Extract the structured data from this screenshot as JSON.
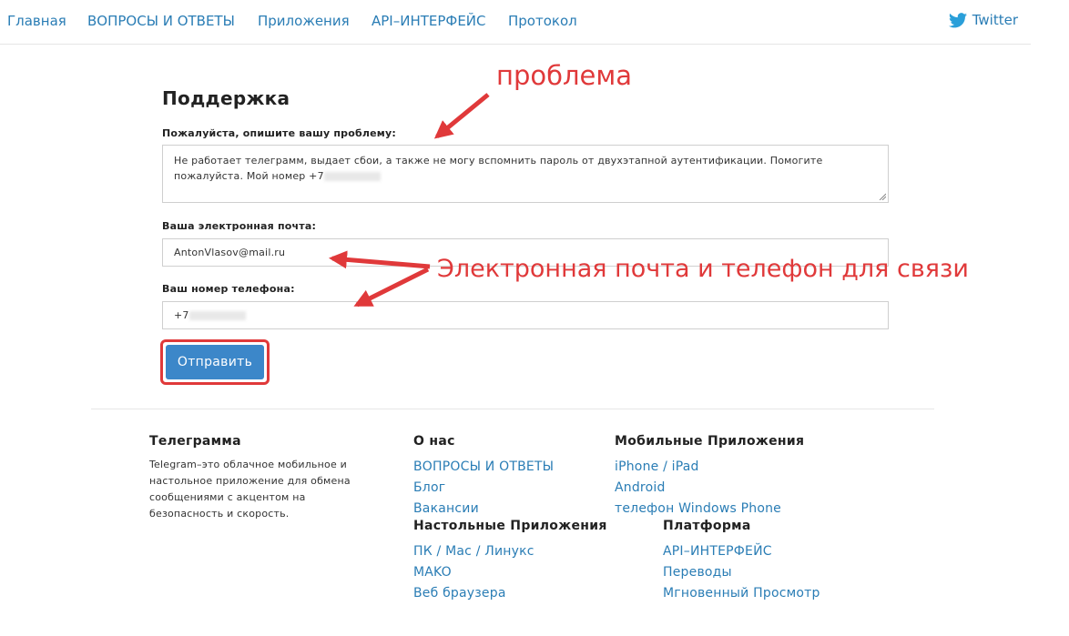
{
  "nav": {
    "items": [
      "Главная",
      "ВОПРОСЫ И ОТВЕТЫ",
      "Приложения",
      "API–ИНТЕРФЕЙС",
      "Протокол"
    ],
    "twitter_label": "Twitter"
  },
  "form": {
    "title": "Поддержка",
    "problem_label": "Пожалуйста, опишите вашу проблему:",
    "problem_text": "Не работает телеграмм, выдает сбои, а также не могу вспомнить пароль от двухэтапной аутентификации. Помогите пожалуйста. Мой номер +7",
    "email_label": "Ваша электронная почта:",
    "email_value": "AntonVlasov@mail.ru",
    "phone_label": "Ваш номер телефона:",
    "phone_value": "+7",
    "submit_label": "Отправить"
  },
  "annotations": {
    "problem": "проблема",
    "contacts": "Электронная почта и телефон для связи",
    "color": "#e0393a"
  },
  "footer": {
    "col1": {
      "title": "Телеграмма",
      "description": "Telegram–это облачное мобильное и настольное приложение для обмена сообщениями с акцентом на безопасность и скорость."
    },
    "about": {
      "title": "О нас",
      "links": [
        "ВОПРОСЫ И ОТВЕТЫ",
        "Блог",
        "Вакансии"
      ]
    },
    "mobile": {
      "title": "Мобильные Приложения",
      "links": [
        "iPhone / iPad",
        "Android",
        "телефон Windows Phone"
      ]
    },
    "desktop": {
      "title": "Настольные Приложения",
      "links": [
        "ПК / Mac / Линукс",
        "MAKO",
        "Веб браузера"
      ]
    },
    "platform": {
      "title": "Платформа",
      "links": [
        "API–ИНТЕРФЕЙС",
        "Переводы",
        "Мгновенный Просмотр"
      ]
    }
  },
  "colors": {
    "link": "#2a7db5",
    "button": "#3c87c9",
    "annotation": "#e0393a"
  }
}
